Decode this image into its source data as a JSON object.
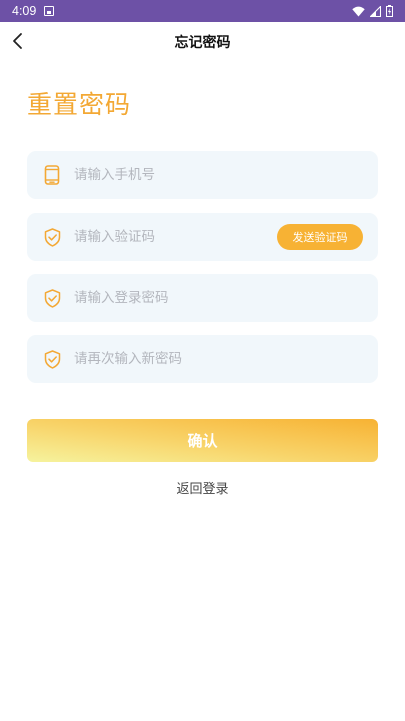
{
  "status_bar": {
    "time": "4:09",
    "bg_color": "#6d51a6"
  },
  "nav": {
    "title": "忘记密码",
    "back_icon": "chevron-left-icon"
  },
  "heading": {
    "text": "重置密码",
    "color": "#f3a834"
  },
  "form": {
    "phone": {
      "placeholder": "请输入手机号",
      "icon": "phone-icon"
    },
    "code": {
      "placeholder": "请输入验证码",
      "icon": "shield-check-icon",
      "send_button": "发送验证码"
    },
    "password": {
      "placeholder": "请输入登录密码",
      "icon": "shield-check-icon"
    },
    "confirm_password": {
      "placeholder": "请再次输入新密码",
      "icon": "shield-check-icon"
    }
  },
  "actions": {
    "confirm_label": "确认",
    "back_login_label": "返回登录"
  },
  "colors": {
    "accent": "#f7b234",
    "field_bg": "#f1f7fb"
  }
}
